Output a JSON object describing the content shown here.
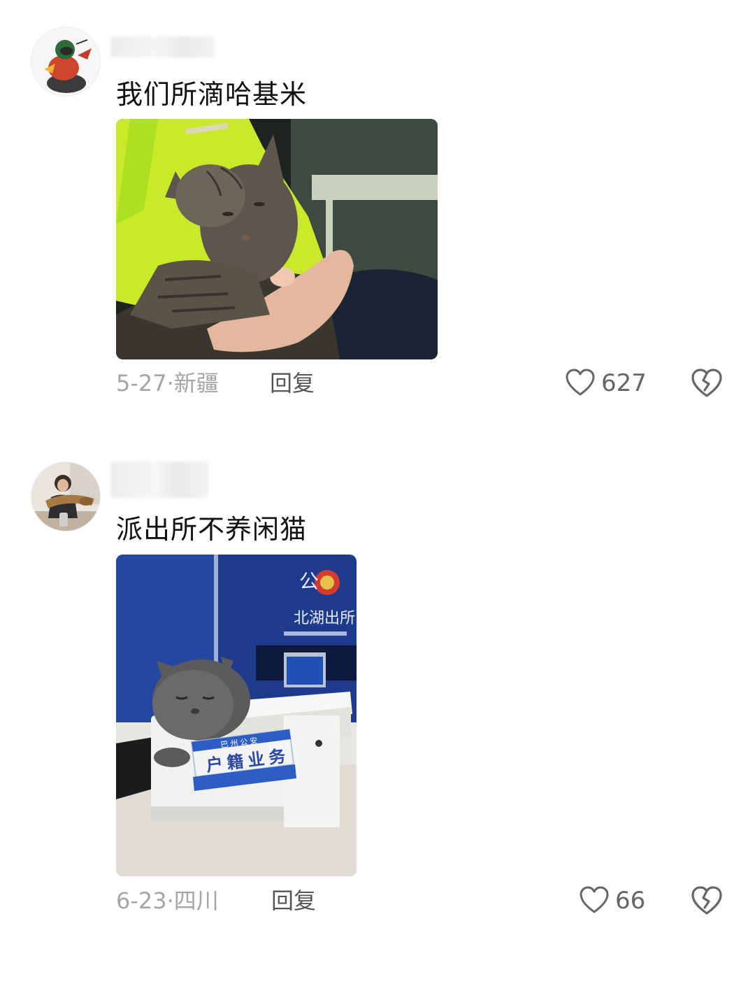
{
  "comments": [
    {
      "text": "我们所滴哈基米",
      "date": "5-27",
      "separator": "·",
      "location": "新疆",
      "reply_label": "回复",
      "likes": "627",
      "icons": {
        "like": "heart-outline-icon",
        "dislike": "broken-heart-icon"
      }
    },
    {
      "text": "派出所不养闲猫",
      "date": "6-23",
      "separator": "·",
      "location": "四川",
      "reply_label": "回复",
      "likes": "66",
      "icons": {
        "like": "heart-outline-icon",
        "dislike": "broken-heart-icon"
      },
      "photo_sign": {
        "top": "巴 州 公 安",
        "main": "户 籍 业 务",
        "wall_text": "北湖出所"
      }
    }
  ],
  "colors": {
    "text": "#111111",
    "meta": "#a5a5a5",
    "reply": "#555555",
    "icon": "#666666"
  }
}
